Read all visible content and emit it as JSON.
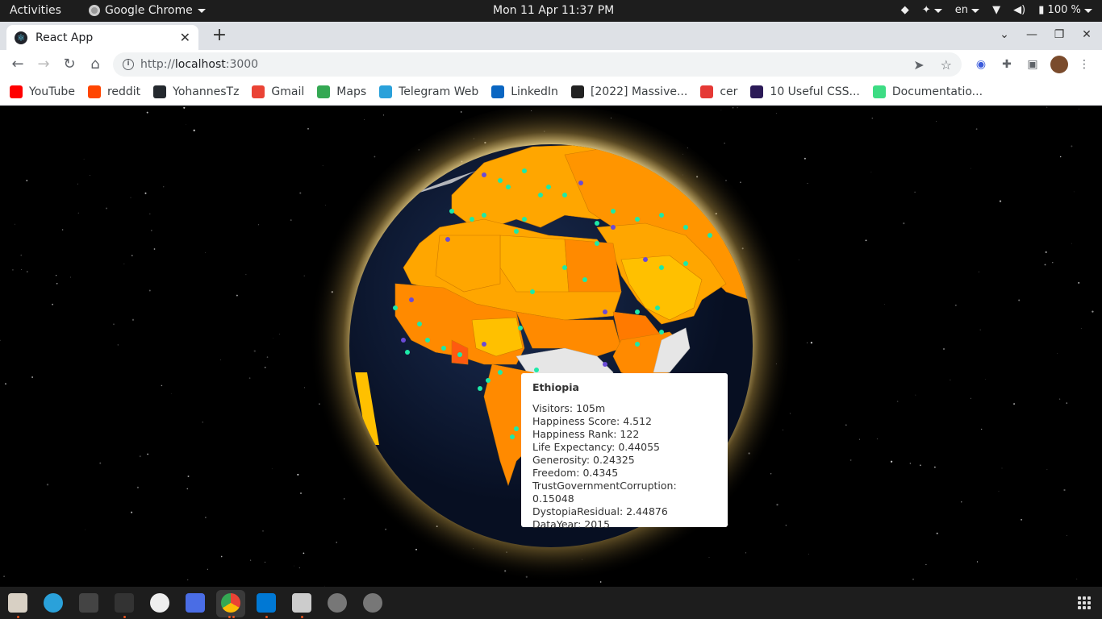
{
  "topbar": {
    "activities": "Activities",
    "app_name": "Google Chrome",
    "clock": "Mon 11 Apr  11:37 PM",
    "language": "en",
    "battery": "100 %"
  },
  "tab": {
    "title": "React App",
    "close": "✕"
  },
  "toolbar": {
    "url_scheme": "http://",
    "url_host": "localhost",
    "url_rest": ":3000"
  },
  "bookmarks": [
    {
      "label": "YouTube",
      "icon": "youtube-icon",
      "color": "#ff0000"
    },
    {
      "label": "reddit",
      "icon": "reddit-icon",
      "color": "#ff4500"
    },
    {
      "label": "YohannesTz",
      "icon": "github-icon",
      "color": "#24292e"
    },
    {
      "label": "Gmail",
      "icon": "gmail-icon",
      "color": "#ea4335"
    },
    {
      "label": "Maps",
      "icon": "maps-icon",
      "color": "#34a853"
    },
    {
      "label": "Telegram Web",
      "icon": "telegram-icon",
      "color": "#2aa1da"
    },
    {
      "label": "LinkedIn",
      "icon": "linkedin-icon",
      "color": "#0a66c2"
    },
    {
      "label": "[2022] Massive...",
      "icon": "course-icon",
      "color": "#222222"
    },
    {
      "label": "cer",
      "icon": "cer-icon",
      "color": "#e53935"
    },
    {
      "label": "10 Useful CSS...",
      "icon": "sd-icon",
      "color": "#2b1a57"
    },
    {
      "label": "Documentatio...",
      "icon": "android-icon",
      "color": "#3ddc84"
    }
  ],
  "tooltip": {
    "country": "Ethiopia",
    "visitors": "Visitors: 105m",
    "happiness_score": "Happiness Score: 4.512",
    "happiness_rank": "Happiness Rank: 122",
    "life_expectancy": "Life Expectancy: 0.44055",
    "generosity": "Generosity: 0.24325",
    "freedom": "Freedom: 0.4345",
    "trust": "TrustGovernmentCorruption: 0.15048",
    "dystopia": "DystopiaResidual: 2.44876",
    "data_year": "DataYear: 2015"
  },
  "colors": {
    "ocean": "#0c1a33",
    "land_light": "#ffc000",
    "land_mid": "#ffa600",
    "land_dark": "#ff8a00",
    "land_red": "#ff6a10",
    "no_data": "#e6e6e6",
    "point_green": "#1de9a8",
    "point_purple": "#6a4bd6",
    "glow": "#ffe8a0"
  }
}
